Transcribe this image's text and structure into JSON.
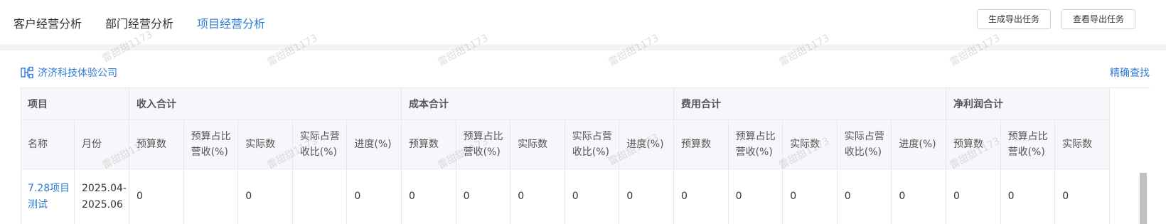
{
  "tabs": [
    {
      "label": "客户经营分析",
      "active": false
    },
    {
      "label": "部门经营分析",
      "active": false
    },
    {
      "label": "项目经营分析",
      "active": true
    }
  ],
  "toolbar": {
    "generate_export": "生成导出任务",
    "view_export": "查看导出任务"
  },
  "company": {
    "name": "济济科技体验公司",
    "icon": "org-chart-icon"
  },
  "precise_search": "精确查找",
  "table": {
    "group_headers": [
      "项目",
      "收入合计",
      "成本合计",
      "费用合计",
      "净利润合计"
    ],
    "sub_headers": [
      "名称",
      "月份",
      "预算数",
      "预算占比营收(%)",
      "实际数",
      "实际占营收比(%)",
      "进度(%)",
      "预算数",
      "预算占比营收(%)",
      "实际数",
      "实际占营收比(%)",
      "进度(%)",
      "预算数",
      "预算占比营收(%)",
      "实际数",
      "实际占营收比(%)",
      "进度(%)",
      "预算数",
      "预算占比营收(%)",
      "实际数"
    ],
    "rows": [
      [
        "7.28项目测试",
        "2025.04-2025.06",
        "0",
        "",
        "0",
        "",
        "0",
        "0",
        "0",
        "0",
        "0",
        "0",
        "0",
        "0",
        "0",
        "0",
        "0",
        "0",
        "0",
        "0"
      ]
    ]
  },
  "watermark": "雷甜甜1173",
  "colors": {
    "accent": "#2f7bd4",
    "header_bg": "#f6f7fa",
    "border": "#e8e8e8"
  }
}
